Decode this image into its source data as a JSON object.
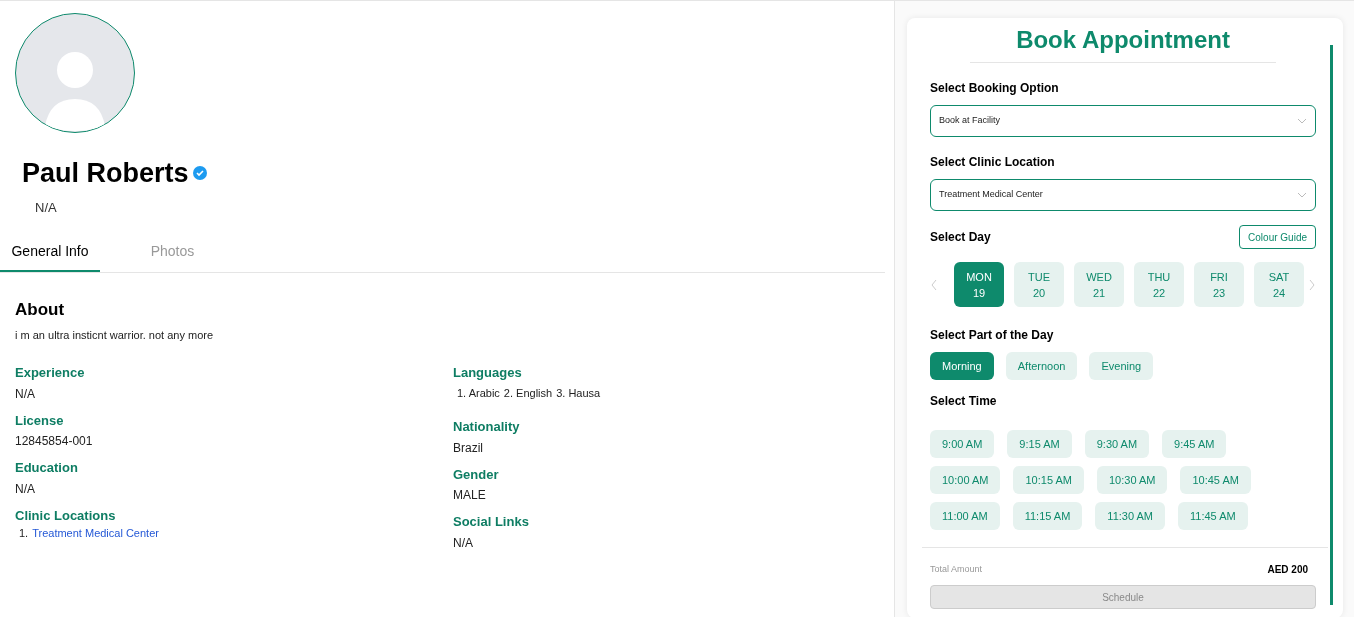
{
  "profile": {
    "name": "Paul Roberts",
    "verified": true,
    "subtitle": "N/A"
  },
  "tabs": [
    {
      "label": "General Info",
      "selected": true
    },
    {
      "label": "Photos",
      "selected": false
    }
  ],
  "about": {
    "title": "About",
    "text": "i m an ultra insticnt warrior. not any more"
  },
  "left_fields": [
    {
      "label": "Experience",
      "value": "N/A"
    },
    {
      "label": "License",
      "value": "12845854-001"
    },
    {
      "label": "Education",
      "value": "N/A"
    }
  ],
  "clinic_locations": {
    "label": "Clinic Locations",
    "items": [
      {
        "marker": "1.",
        "name": "Treatment Medical Center"
      }
    ]
  },
  "languages": {
    "label": "Languages",
    "items": [
      {
        "marker": "1.",
        "name": "Arabic"
      },
      {
        "marker": "2.",
        "name": "English"
      },
      {
        "marker": "3.",
        "name": "Hausa"
      }
    ]
  },
  "right_fields": [
    {
      "label": "Nationality",
      "value": "Brazil"
    },
    {
      "label": "Gender",
      "value": "MALE"
    },
    {
      "label": "Social Links",
      "value": "N/A"
    }
  ],
  "booking": {
    "title": "Book Appointment",
    "booking_option": {
      "label": "Select Booking Option",
      "value": "Book at Facility"
    },
    "clinic_location": {
      "label": "Select Clinic Location",
      "value": "Treatment Medical Center"
    },
    "day_label": "Select Day",
    "colour_guide": "Colour Guide",
    "days": [
      {
        "day": "MON",
        "date": "19",
        "selected": true
      },
      {
        "day": "TUE",
        "date": "20",
        "selected": false
      },
      {
        "day": "WED",
        "date": "21",
        "selected": false
      },
      {
        "day": "THU",
        "date": "22",
        "selected": false
      },
      {
        "day": "FRI",
        "date": "23",
        "selected": false
      },
      {
        "day": "SAT",
        "date": "24",
        "selected": false
      }
    ],
    "part_label": "Select Part of the Day",
    "parts": [
      {
        "label": "Morning",
        "selected": true
      },
      {
        "label": "Afternoon",
        "selected": false
      },
      {
        "label": "Evening",
        "selected": false
      }
    ],
    "time_label": "Select Time",
    "time_rows": [
      [
        {
          "label": "9:00 AM",
          "selected": false
        },
        {
          "label": "9:15 AM",
          "selected": false
        },
        {
          "label": "9:30 AM",
          "selected": false
        },
        {
          "label": "9:45 AM",
          "selected": false
        }
      ],
      [
        {
          "label": "10:00 AM",
          "selected": false
        },
        {
          "label": "10:15 AM",
          "selected": false
        },
        {
          "label": "10:30 AM",
          "selected": false
        },
        {
          "label": "10:45 AM",
          "selected": false
        }
      ],
      [
        {
          "label": "11:00 AM",
          "selected": false
        },
        {
          "label": "11:15 AM",
          "selected": false
        },
        {
          "label": "11:30 AM",
          "selected": false
        },
        {
          "label": "11:45 AM",
          "selected": false
        }
      ]
    ],
    "total_label": "Total Amount",
    "total_value": "AED 200",
    "schedule": {
      "label": "Schedule",
      "disabled": true
    }
  }
}
